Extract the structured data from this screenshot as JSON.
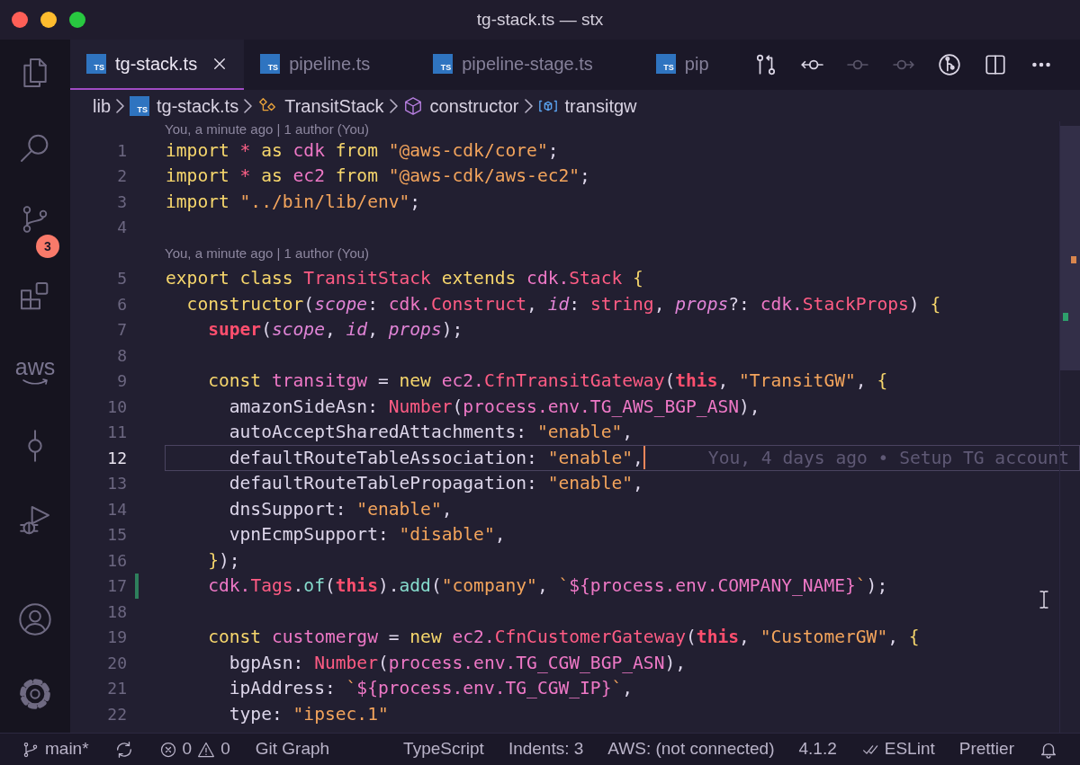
{
  "window": {
    "title": "tg-stack.ts — stx"
  },
  "activity_bar": {
    "items": [
      {
        "kind": "files"
      },
      {
        "kind": "search"
      },
      {
        "kind": "scm",
        "badge": "3"
      },
      {
        "kind": "extensions"
      },
      {
        "kind": "aws",
        "label": "aws"
      },
      {
        "kind": "commits"
      },
      {
        "kind": "debug"
      }
    ],
    "bottom": [
      {
        "kind": "account"
      },
      {
        "kind": "settings"
      }
    ]
  },
  "tabs": [
    {
      "icon": "TS",
      "label": "tg-stack.ts",
      "selected": true
    },
    {
      "icon": "TS",
      "label": "pipeline.ts",
      "selected": false
    },
    {
      "icon": "TS",
      "label": "pipeline-stage.ts",
      "selected": false
    },
    {
      "icon": "TS",
      "label": "pip",
      "selected": false
    }
  ],
  "editor_actions": [
    {
      "kind": "compare",
      "disabled": false
    },
    {
      "kind": "previous",
      "disabled": false
    },
    {
      "kind": "commit",
      "disabled": true
    },
    {
      "kind": "next",
      "disabled": true
    },
    {
      "kind": "graph",
      "disabled": false
    },
    {
      "kind": "split",
      "disabled": false
    },
    {
      "kind": "more",
      "disabled": false
    }
  ],
  "breadcrumbs": [
    {
      "kind": "folder",
      "text": "lib"
    },
    {
      "kind": "file",
      "icon": "TS",
      "text": "tg-stack.ts"
    },
    {
      "kind": "class",
      "text": "TransitStack"
    },
    {
      "kind": "method",
      "text": "constructor"
    },
    {
      "kind": "variable",
      "text": "transitgw"
    }
  ],
  "editor": {
    "lines": [
      {
        "kind": "lens",
        "text": "You, a minute ago | 1 author (You)"
      },
      {
        "kind": "code",
        "number": "1",
        "current": false,
        "modified": false,
        "tokens": [
          {
            "kind": "kw",
            "text": "import "
          },
          {
            "kind": "op",
            "text": "* "
          },
          {
            "kind": "kw",
            "text": "as "
          },
          {
            "kind": "var",
            "text": "cdk "
          },
          {
            "kind": "kw",
            "text": "from "
          },
          {
            "kind": "str",
            "text": "\"@aws-cdk/core\""
          },
          {
            "kind": "pl",
            "text": ";"
          }
        ]
      },
      {
        "kind": "code",
        "number": "2",
        "current": false,
        "modified": false,
        "tokens": [
          {
            "kind": "kw",
            "text": "import "
          },
          {
            "kind": "op",
            "text": "* "
          },
          {
            "kind": "kw",
            "text": "as "
          },
          {
            "kind": "var",
            "text": "ec2 "
          },
          {
            "kind": "kw",
            "text": "from "
          },
          {
            "kind": "str",
            "text": "\"@aws-cdk/aws-ec2\""
          },
          {
            "kind": "pl",
            "text": ";"
          }
        ]
      },
      {
        "kind": "code",
        "number": "3",
        "current": false,
        "modified": false,
        "tokens": [
          {
            "kind": "kw",
            "text": "import "
          },
          {
            "kind": "str",
            "text": "\"../bin/lib/env\""
          },
          {
            "kind": "pl",
            "text": ";"
          }
        ]
      },
      {
        "kind": "code",
        "number": "4",
        "current": false,
        "modified": false
      },
      {
        "kind": "lens",
        "text": "You, a minute ago | 1 author (You)"
      },
      {
        "kind": "code",
        "number": "5",
        "current": false,
        "modified": false,
        "tokens": [
          {
            "kind": "kw",
            "text": "export class "
          },
          {
            "kind": "type",
            "text": "TransitStack "
          },
          {
            "kind": "kw",
            "text": "extends "
          },
          {
            "kind": "var",
            "text": "cdk."
          },
          {
            "kind": "type",
            "text": "Stack "
          },
          {
            "kind": "kw",
            "text": "{"
          }
        ]
      },
      {
        "kind": "code",
        "number": "6",
        "current": false,
        "modified": false,
        "tokens": [
          {
            "kind": "kw",
            "text": "  constructor"
          },
          {
            "kind": "pl",
            "text": "("
          },
          {
            "kind": "param",
            "text": "scope"
          },
          {
            "kind": "pl",
            "text": ": "
          },
          {
            "kind": "var",
            "text": "cdk."
          },
          {
            "kind": "type",
            "text": "Construct"
          },
          {
            "kind": "pl",
            "text": ", "
          },
          {
            "kind": "param",
            "text": "id"
          },
          {
            "kind": "pl",
            "text": ": "
          },
          {
            "kind": "type",
            "text": "string"
          },
          {
            "kind": "pl",
            "text": ", "
          },
          {
            "kind": "param",
            "text": "props"
          },
          {
            "kind": "pl",
            "text": "?: "
          },
          {
            "kind": "var",
            "text": "cdk."
          },
          {
            "kind": "type",
            "text": "StackProps"
          },
          {
            "kind": "pl",
            "text": ") "
          },
          {
            "kind": "kw",
            "text": "{"
          }
        ]
      },
      {
        "kind": "code",
        "number": "7",
        "current": false,
        "modified": false,
        "tokens": [
          {
            "kind": "self",
            "text": "    super"
          },
          {
            "kind": "pl",
            "text": "("
          },
          {
            "kind": "param",
            "text": "scope"
          },
          {
            "kind": "pl",
            "text": ", "
          },
          {
            "kind": "param",
            "text": "id"
          },
          {
            "kind": "pl",
            "text": ", "
          },
          {
            "kind": "param",
            "text": "props"
          },
          {
            "kind": "pl",
            "text": ");"
          }
        ]
      },
      {
        "kind": "code",
        "number": "8",
        "current": false,
        "modified": false
      },
      {
        "kind": "code",
        "number": "9",
        "current": false,
        "modified": false,
        "tokens": [
          {
            "kind": "kw",
            "text": "    const "
          },
          {
            "kind": "var",
            "text": "transitgw "
          },
          {
            "kind": "pl",
            "text": "= "
          },
          {
            "kind": "kw",
            "text": "new "
          },
          {
            "kind": "var",
            "text": "ec2."
          },
          {
            "kind": "type",
            "text": "CfnTransitGateway"
          },
          {
            "kind": "pl",
            "text": "("
          },
          {
            "kind": "self",
            "text": "this"
          },
          {
            "kind": "pl",
            "text": ", "
          },
          {
            "kind": "str",
            "text": "\"TransitGW\""
          },
          {
            "kind": "pl",
            "text": ", "
          },
          {
            "kind": "kw",
            "text": "{"
          }
        ]
      },
      {
        "kind": "code",
        "number": "10",
        "current": false,
        "modified": false,
        "tokens": [
          {
            "kind": "pl",
            "text": "      amazonSideAsn: "
          },
          {
            "kind": "type",
            "text": "Number"
          },
          {
            "kind": "pl",
            "text": "("
          },
          {
            "kind": "var",
            "text": "process.env.TG_AWS_BGP_ASN"
          },
          {
            "kind": "pl",
            "text": "),"
          }
        ]
      },
      {
        "kind": "code",
        "number": "11",
        "current": false,
        "modified": false,
        "tokens": [
          {
            "kind": "pl",
            "text": "      autoAcceptSharedAttachments: "
          },
          {
            "kind": "str",
            "text": "\"enable\""
          },
          {
            "kind": "pl",
            "text": ","
          }
        ]
      },
      {
        "kind": "code",
        "number": "12",
        "current": true,
        "modified": false,
        "blame": "You, 4 days ago • Setup TG account",
        "tokens": [
          {
            "kind": "pl",
            "text": "      defaultRouteTableAssociation: "
          },
          {
            "kind": "str",
            "text": "\"enable\""
          },
          {
            "kind": "pl",
            "text": ","
          }
        ]
      },
      {
        "kind": "code",
        "number": "13",
        "current": false,
        "modified": false,
        "tokens": [
          {
            "kind": "pl",
            "text": "      defaultRouteTablePropagation: "
          },
          {
            "kind": "str",
            "text": "\"enable\""
          },
          {
            "kind": "pl",
            "text": ","
          }
        ]
      },
      {
        "kind": "code",
        "number": "14",
        "current": false,
        "modified": false,
        "tokens": [
          {
            "kind": "pl",
            "text": "      dnsSupport: "
          },
          {
            "kind": "str",
            "text": "\"enable\""
          },
          {
            "kind": "pl",
            "text": ","
          }
        ]
      },
      {
        "kind": "code",
        "number": "15",
        "current": false,
        "modified": false,
        "tokens": [
          {
            "kind": "pl",
            "text": "      vpnEcmpSupport: "
          },
          {
            "kind": "str",
            "text": "\"disable\""
          },
          {
            "kind": "pl",
            "text": ","
          }
        ]
      },
      {
        "kind": "code",
        "number": "16",
        "current": false,
        "modified": false,
        "tokens": [
          {
            "kind": "kw",
            "text": "    }"
          },
          {
            "kind": "pl",
            "text": ");"
          }
        ]
      },
      {
        "kind": "code",
        "number": "17",
        "current": false,
        "modified": true,
        "tokens": [
          {
            "kind": "var",
            "text": "    cdk."
          },
          {
            "kind": "type",
            "text": "Tags"
          },
          {
            "kind": "pl",
            "text": "."
          },
          {
            "kind": "fn",
            "text": "of"
          },
          {
            "kind": "pl",
            "text": "("
          },
          {
            "kind": "self",
            "text": "this"
          },
          {
            "kind": "pl",
            "text": ")."
          },
          {
            "kind": "fn",
            "text": "add"
          },
          {
            "kind": "pl",
            "text": "("
          },
          {
            "kind": "str",
            "text": "\"company\""
          },
          {
            "kind": "pl",
            "text": ", "
          },
          {
            "kind": "str",
            "text": "`"
          },
          {
            "kind": "var",
            "text": "${process.env.COMPANY_NAME}"
          },
          {
            "kind": "str",
            "text": "`"
          },
          {
            "kind": "pl",
            "text": ");"
          }
        ]
      },
      {
        "kind": "code",
        "number": "18",
        "current": false,
        "modified": false
      },
      {
        "kind": "code",
        "number": "19",
        "current": false,
        "modified": false,
        "tokens": [
          {
            "kind": "kw",
            "text": "    const "
          },
          {
            "kind": "var",
            "text": "customergw "
          },
          {
            "kind": "pl",
            "text": "= "
          },
          {
            "kind": "kw",
            "text": "new "
          },
          {
            "kind": "var",
            "text": "ec2."
          },
          {
            "kind": "type",
            "text": "CfnCustomerGateway"
          },
          {
            "kind": "pl",
            "text": "("
          },
          {
            "kind": "self",
            "text": "this"
          },
          {
            "kind": "pl",
            "text": ", "
          },
          {
            "kind": "str",
            "text": "\"CustomerGW\""
          },
          {
            "kind": "pl",
            "text": ", "
          },
          {
            "kind": "kw",
            "text": "{"
          }
        ]
      },
      {
        "kind": "code",
        "number": "20",
        "current": false,
        "modified": false,
        "tokens": [
          {
            "kind": "pl",
            "text": "      bgpAsn: "
          },
          {
            "kind": "type",
            "text": "Number"
          },
          {
            "kind": "pl",
            "text": "("
          },
          {
            "kind": "var",
            "text": "process.env.TG_CGW_BGP_ASN"
          },
          {
            "kind": "pl",
            "text": "),"
          }
        ]
      },
      {
        "kind": "code",
        "number": "21",
        "current": false,
        "modified": false,
        "tokens": [
          {
            "kind": "pl",
            "text": "      ipAddress: "
          },
          {
            "kind": "str",
            "text": "`"
          },
          {
            "kind": "var",
            "text": "${process.env.TG_CGW_IP}"
          },
          {
            "kind": "str",
            "text": "`"
          },
          {
            "kind": "pl",
            "text": ","
          }
        ]
      },
      {
        "kind": "code",
        "number": "22",
        "current": false,
        "modified": false,
        "tokens": [
          {
            "kind": "pl",
            "text": "      type: "
          },
          {
            "kind": "str",
            "text": "\"ipsec.1\""
          }
        ]
      }
    ]
  },
  "status_bar": {
    "left": [
      {
        "kind": "branch",
        "text": "main*"
      },
      {
        "kind": "sync"
      },
      {
        "kind": "problems",
        "errors": "0",
        "warnings": "0"
      },
      {
        "kind": "text",
        "text": "Git Graph"
      }
    ],
    "right": [
      {
        "kind": "text",
        "text": "TypeScript"
      },
      {
        "kind": "text",
        "text": "Indents: 3"
      },
      {
        "kind": "text",
        "text": "AWS: (not connected)"
      },
      {
        "kind": "text",
        "text": "4.1.2"
      },
      {
        "kind": "lint",
        "text": "ESLint"
      },
      {
        "kind": "text",
        "text": "Prettier"
      },
      {
        "kind": "bell"
      }
    ]
  }
}
